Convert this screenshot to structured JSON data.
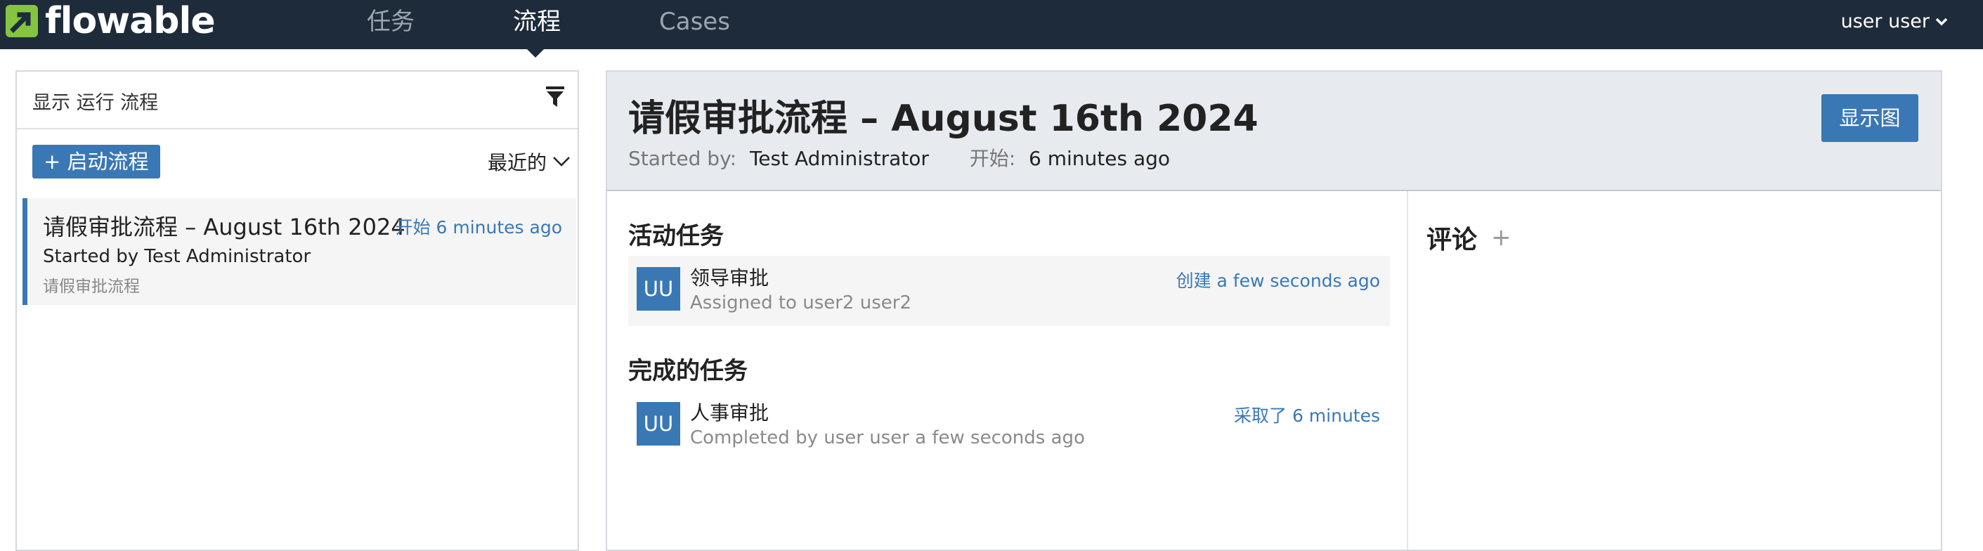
{
  "navbar": {
    "logo_text": "flowable",
    "tabs": [
      {
        "label": "任务",
        "active": false
      },
      {
        "label": "流程",
        "active": true
      },
      {
        "label": "Cases",
        "active": false
      }
    ],
    "user_label": "user user",
    "bg_color": "#1e2b3a",
    "brand_green": "#84c441"
  },
  "left_panel": {
    "filter_text": "显示 运行 流程",
    "start_button": "+ 启动流程",
    "sort_label": "最近的",
    "items": [
      {
        "title": "请假审批流程 – August 16th 2024",
        "time": "开始 6 minutes ago",
        "starter": "Started by Test Administrator",
        "definition": "请假审批流程"
      }
    ]
  },
  "detail": {
    "title": "请假审批流程 – August 16th 2024",
    "started_by_label": "Started by:",
    "started_by_value": "Test Administrator",
    "start_label": "开始:",
    "start_value": "6 minutes ago",
    "diagram_button": "显示图",
    "active_tasks_heading": "活动任务",
    "active_tasks": [
      {
        "avatar": "UU",
        "name": "领导审批",
        "sub": "Assigned to user2 user2",
        "time": "创建 a few seconds ago"
      }
    ],
    "completed_tasks_heading": "完成的任务",
    "completed_tasks": [
      {
        "avatar": "UU",
        "name": "人事审批",
        "sub": "Completed by user user a few seconds ago",
        "time": "采取了 6 minutes"
      }
    ],
    "comments_heading": "评论",
    "add_comment_symbol": "+"
  },
  "colors": {
    "accent": "#3a78b5",
    "header_bg": "#e7ebf0"
  }
}
